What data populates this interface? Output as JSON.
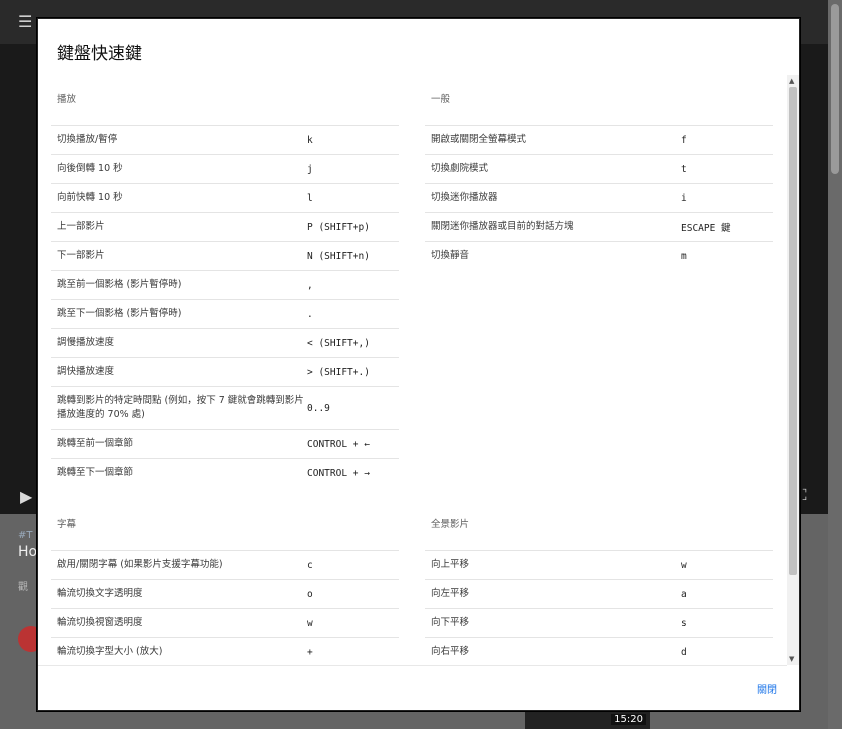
{
  "background": {
    "hashtag": "#T",
    "title_fragment": "Ho",
    "sub_fragment": "觀",
    "thumb_time": "15:20"
  },
  "dialog": {
    "title": "鍵盤快速鍵",
    "close_label": "關閉",
    "sections": {
      "playback": {
        "title": "播放",
        "rows": [
          {
            "desc": "切換播放/暫停",
            "key": "k"
          },
          {
            "desc": "向後倒轉 10 秒",
            "key": "j"
          },
          {
            "desc": "向前快轉 10 秒",
            "key": "l"
          },
          {
            "desc": "上一部影片",
            "key": "P (SHIFT+p)"
          },
          {
            "desc": "下一部影片",
            "key": "N (SHIFT+n)"
          },
          {
            "desc": "跳至前一個影格 (影片暫停時)",
            "key": ","
          },
          {
            "desc": "跳至下一個影格 (影片暫停時)",
            "key": "."
          },
          {
            "desc": "調慢播放速度",
            "key": "< (SHIFT+,)"
          },
          {
            "desc": "調快播放速度",
            "key": "> (SHIFT+.)"
          },
          {
            "desc": "跳轉到影片的特定時間點 (例如，按下 7 鍵就會跳轉到影片播放進度的 70% 處)",
            "key": "0..9"
          },
          {
            "desc": "跳轉至前一個章節",
            "key": "CONTROL + ←"
          },
          {
            "desc": "跳轉至下一個章節",
            "key": "CONTROL + →"
          }
        ]
      },
      "general": {
        "title": "一般",
        "rows": [
          {
            "desc": "開啟或關閉全螢幕模式",
            "key": "f"
          },
          {
            "desc": "切換劇院模式",
            "key": "t"
          },
          {
            "desc": "切換迷你播放器",
            "key": "i"
          },
          {
            "desc": "關閉迷你播放器或目前的對話方塊",
            "key": "ESCAPE 鍵"
          },
          {
            "desc": "切換靜音",
            "key": "m"
          }
        ]
      },
      "subtitles": {
        "title": "字幕",
        "rows": [
          {
            "desc": "啟用/關閉字幕 (如果影片支援字幕功能)",
            "key": "c"
          },
          {
            "desc": "輪流切換文字透明度",
            "key": "o"
          },
          {
            "desc": "輪流切換視窗透明度",
            "key": "w"
          },
          {
            "desc": "輪流切換字型大小 (放大)",
            "key": "+"
          }
        ]
      },
      "spherical": {
        "title": "全景影片",
        "rows": [
          {
            "desc": "向上平移",
            "key": "w"
          },
          {
            "desc": "向左平移",
            "key": "a"
          },
          {
            "desc": "向下平移",
            "key": "s"
          },
          {
            "desc": "向右平移",
            "key": "d"
          }
        ]
      }
    }
  }
}
